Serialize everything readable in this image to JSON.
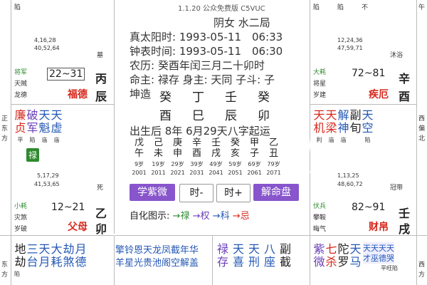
{
  "watermark": "1.1.20 公众免费版 C5VUC",
  "top_left": {
    "stars_row1": [
      "陷"
    ],
    "label": ""
  },
  "top_right_header": {
    "cells": [
      "陷",
      "陷",
      "不"
    ]
  },
  "right_edge_top": "午",
  "center": {
    "line1": "阴女 水二局",
    "line2": "真太阳时: 1993-05-11　06:33",
    "line3": "钟表时间: 1993-05-11　06:30",
    "line4": "农历: 癸酉年闰三月二十卯时",
    "line5": "命主: 禄存 身主: 天同 子斗: 子",
    "line6_label": "坤造",
    "pillars": [
      "癸",
      "丁",
      "壬",
      "癸"
    ],
    "pillars2": [
      "酉",
      "巳",
      "辰",
      "卯"
    ],
    "line8": "出生后 8年 6月29天八字起运",
    "luck_top": [
      "戊",
      "己",
      "庚",
      "辛",
      "壬",
      "癸",
      "甲",
      "乙"
    ],
    "luck_bottom": [
      "午",
      "未",
      "申",
      "酉",
      "戌",
      "亥",
      "子",
      "丑"
    ],
    "ages": [
      "9岁",
      "19岁",
      "29岁",
      "39岁",
      "49岁",
      "59岁",
      "69岁",
      "79岁"
    ],
    "years": [
      "2001",
      "2011",
      "2021",
      "2031",
      "2041",
      "2051",
      "2061",
      "2071"
    ],
    "buttons": {
      "b1": "学紫微",
      "b2": "时-",
      "b3": "时+",
      "b4": "解命盘"
    },
    "legend_label": "自化图示:",
    "legend_items": [
      "禄",
      "权",
      "科",
      "忌"
    ]
  },
  "palace_left_upper": {
    "nums": [
      "4,16,28",
      "40,52,64"
    ],
    "tag": "墓",
    "god1": "将军",
    "god2": "天贼",
    "god3": "龙德",
    "age": "22~31",
    "name": "丙",
    "name2": "辰",
    "type": "福德"
  },
  "palace_left_middle": {
    "stars": [
      "廉",
      "破",
      "天",
      "天"
    ],
    "stars2": [
      "贞",
      "军",
      "魁",
      "虚"
    ],
    "bright": [
      "平",
      "陷",
      "庙",
      "庙"
    ],
    "lu": "禄",
    "nums": [
      "5,17,29",
      "41,53,65"
    ],
    "tag": "死",
    "god1": "小耗",
    "god2": "灾煞",
    "god3": "岁破",
    "age": "12~21",
    "name": "乙",
    "name2": "卯",
    "type": "父母"
  },
  "palace_bottom_left": {
    "stars": [
      "地",
      "三",
      "天",
      "大",
      "劫",
      "月"
    ],
    "stars2": [
      "劫",
      "台",
      "月",
      "耗",
      "煞",
      "德"
    ],
    "bright": [
      "陷"
    ]
  },
  "palace_bottom_center": {
    "line1": "擎铃恩天龙凤截年华",
    "line2": "羊星光贵池阁空解盖",
    "stars": [
      "禄",
      "天",
      "天",
      "八",
      "副"
    ],
    "stars2": [
      "存",
      "喜",
      "刑",
      "座",
      "截"
    ]
  },
  "palace_bottom_right": {
    "stars": [
      "紫",
      "七",
      "陀",
      "天"
    ],
    "stars2": [
      "微",
      "杀",
      "罗",
      "马"
    ],
    "extra1": "天天天天",
    "extra2": "才巫德哭",
    "extra3": "平旺陷"
  },
  "palace_right_upper": {
    "nums": [
      "12,24,36",
      "47,59,71"
    ],
    "tag": "沐浴",
    "god1": "大耗",
    "god2": "将星",
    "god3": "岁建",
    "age": "72~81",
    "name": "辛",
    "name2": "酉",
    "type": "疾厄"
  },
  "palace_right_middle": {
    "stars": [
      "天",
      "天",
      "解",
      "副",
      "天"
    ],
    "stars2": [
      "机",
      "梁",
      "神",
      "旬",
      "空"
    ],
    "bright": [
      "利",
      "庙",
      "庙",
      "陷"
    ],
    "nums": [
      "1,13,25",
      "48,60,72"
    ],
    "tag": "冠带",
    "god1": "伏兵",
    "god2": "攀鞍",
    "god3": "晦气",
    "age": "82~91",
    "name": "壬",
    "name2": "戌",
    "type": "财帛"
  },
  "left_edge": [
    "正",
    "东",
    "方"
  ],
  "right_edge": [
    "西",
    "偏",
    "北"
  ],
  "left_bottom_edge": [
    "东",
    "方"
  ],
  "right_bottom_edge": [
    "西",
    "方"
  ]
}
